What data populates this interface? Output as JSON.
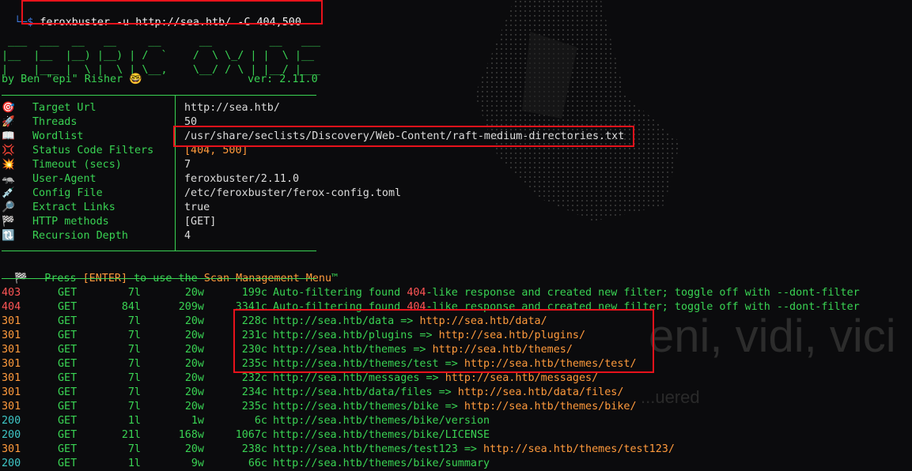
{
  "command": "feroxbuster -u http://sea.htb/ -C 404,500",
  "banner": {
    "art": [
      " ___  ___  __   __     __      __         __   ___",
      "|__  |__  |__) |__) | /  `    /  \\ \\_/ | |  \\ |__",
      "|    |___ |  \\ |  \\ | \\__,    \\__/ / \\ | |__/ |___"
    ],
    "author": "by Ben \"epi\" Risher 🤓",
    "version": "ver: 2.11.0"
  },
  "config": [
    {
      "icon": "🎯",
      "icon_name": "target-icon",
      "label": "Target Url",
      "value": "http://sea.htb/"
    },
    {
      "icon": "🚀",
      "icon_name": "rocket-icon",
      "label": "Threads",
      "value": "50"
    },
    {
      "icon": "📖",
      "icon_name": "book-icon",
      "label": "Wordlist",
      "value": "/usr/share/seclists/Discovery/Web-Content/raft-medium-directories.txt"
    },
    {
      "icon": "💢",
      "icon_name": "anger-icon",
      "label": "Status Code Filters",
      "value": "[404, 500]"
    },
    {
      "icon": "💥",
      "icon_name": "collision-icon",
      "label": "Timeout (secs)",
      "value": "7"
    },
    {
      "icon": "🦡",
      "icon_name": "badger-icon",
      "label": "User-Agent",
      "value": "feroxbuster/2.11.0"
    },
    {
      "icon": "💉",
      "icon_name": "syringe-icon",
      "label": "Config File",
      "value": "/etc/feroxbuster/ferox-config.toml"
    },
    {
      "icon": "🔎",
      "icon_name": "magnifier-icon",
      "label": "Extract Links",
      "value": "true"
    },
    {
      "icon": "🏁",
      "icon_name": "flag-icon",
      "label": "HTTP methods",
      "value": "[GET]"
    },
    {
      "icon": "🔃",
      "icon_name": "recursion-icon",
      "label": "Recursion Depth",
      "value": "4"
    }
  ],
  "menu_hint": {
    "icon": "🏁",
    "pre": "Press ",
    "key": "[ENTER]",
    "mid": " to use the ",
    "menu": "Scan Management Menu",
    "tm": "™"
  },
  "results": [
    {
      "status": "403",
      "method": "GET",
      "lines": "7l",
      "words": "20w",
      "chars": "199c",
      "msg_pre": "Auto-filtering found ",
      "msg_code": "404",
      "msg_post": "-like response and created new filter; toggle off with --dont-filter",
      "type": "filter"
    },
    {
      "status": "404",
      "method": "GET",
      "lines": "84l",
      "words": "209w",
      "chars": "3341c",
      "msg_pre": "Auto-filtering found ",
      "msg_code": "404",
      "msg_post": "-like response and created new filter; toggle off with --dont-filter",
      "type": "filter"
    },
    {
      "status": "301",
      "method": "GET",
      "lines": "7l",
      "words": "20w",
      "chars": "228c",
      "url": "http://sea.htb/data",
      "arrow": " => ",
      "redirect": "http://sea.htb/data/",
      "type": "redirect"
    },
    {
      "status": "301",
      "method": "GET",
      "lines": "7l",
      "words": "20w",
      "chars": "231c",
      "url": "http://sea.htb/plugins",
      "arrow": " => ",
      "redirect": "http://sea.htb/plugins/",
      "type": "redirect"
    },
    {
      "status": "301",
      "method": "GET",
      "lines": "7l",
      "words": "20w",
      "chars": "230c",
      "url": "http://sea.htb/themes",
      "arrow": " => ",
      "redirect": "http://sea.htb/themes/",
      "type": "redirect"
    },
    {
      "status": "301",
      "method": "GET",
      "lines": "7l",
      "words": "20w",
      "chars": "235c",
      "url": "http://sea.htb/themes/test",
      "arrow": " => ",
      "redirect": "http://sea.htb/themes/test/",
      "type": "redirect"
    },
    {
      "status": "301",
      "method": "GET",
      "lines": "7l",
      "words": "20w",
      "chars": "232c",
      "url": "http://sea.htb/messages",
      "arrow": " => ",
      "redirect": "http://sea.htb/messages/",
      "type": "redirect"
    },
    {
      "status": "301",
      "method": "GET",
      "lines": "7l",
      "words": "20w",
      "chars": "234c",
      "url": "http://sea.htb/data/files",
      "arrow": " => ",
      "redirect": "http://sea.htb/data/files/",
      "type": "redirect"
    },
    {
      "status": "301",
      "method": "GET",
      "lines": "7l",
      "words": "20w",
      "chars": "235c",
      "url": "http://sea.htb/themes/bike",
      "arrow": " => ",
      "redirect": "http://sea.htb/themes/bike/",
      "type": "redirect"
    },
    {
      "status": "200",
      "method": "GET",
      "lines": "1l",
      "words": "1w",
      "chars": "6c",
      "url": "http://sea.htb/themes/bike/version",
      "type": "ok"
    },
    {
      "status": "200",
      "method": "GET",
      "lines": "21l",
      "words": "168w",
      "chars": "1067c",
      "url": "http://sea.htb/themes/bike/LICENSE",
      "type": "ok"
    },
    {
      "status": "301",
      "method": "GET",
      "lines": "7l",
      "words": "20w",
      "chars": "238c",
      "url": "http://sea.htb/themes/test123",
      "arrow": " => ",
      "redirect": "http://sea.htb/themes/test123/",
      "type": "redirect"
    },
    {
      "status": "200",
      "method": "GET",
      "lines": "1l",
      "words": "9w",
      "chars": "66c",
      "url": "http://sea.htb/themes/bike/summary",
      "type": "ok"
    }
  ],
  "colors": {
    "background": "#0b0b0d",
    "green": "#39d353",
    "orange": "#ff9a3c",
    "red": "#ff5555",
    "teal": "#3ec6c6",
    "highlight": "#e8121b"
  },
  "background_art": {
    "text": "eni, vidi, vici",
    "subtext": "...uered"
  }
}
